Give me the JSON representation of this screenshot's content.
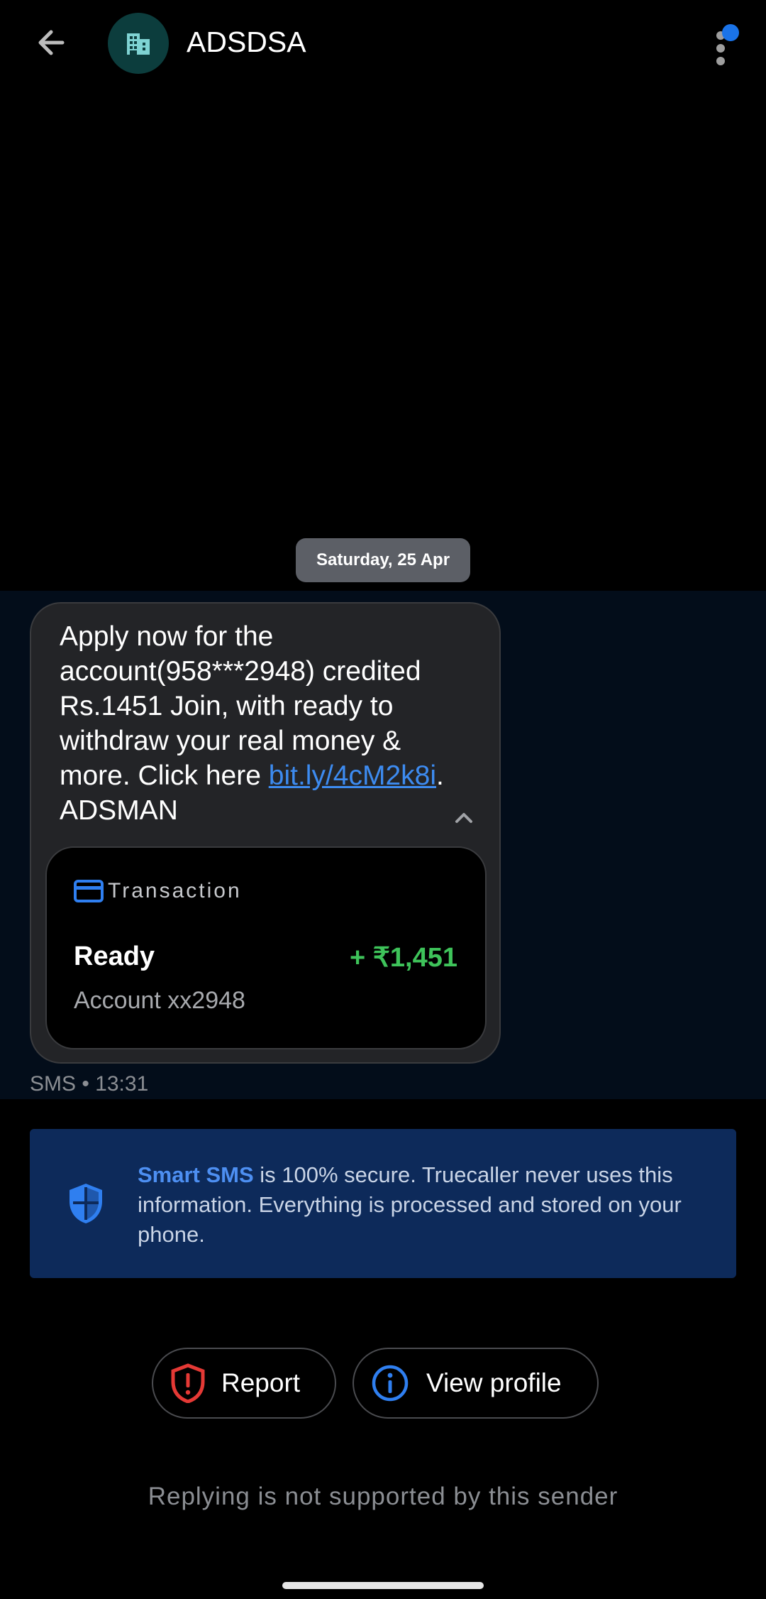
{
  "header": {
    "sender_name": "ADSDSA",
    "back_icon": "arrow-left-icon",
    "avatar_icon": "building-icon",
    "menu_icon": "more-vertical-icon",
    "notification_dot_color": "#1a73e8"
  },
  "conversation": {
    "date": "Saturday, 25 Apr",
    "message": {
      "text_before_link": "Apply now for the account(958***2948) credited Rs.1451 Join, with ready to withdraw your real money & more. Click here ",
      "link": "bit.ly/4cM2k8i",
      "text_after_link": ". ADSMAN",
      "meta": "SMS • 13:31"
    },
    "transaction_card": {
      "label": "Transaction",
      "status": "Ready",
      "amount": "+ ₹1,451",
      "account": "Account xx2948",
      "amount_color": "#3ec35a"
    }
  },
  "smart_sms": {
    "highlight": "Smart SMS",
    "text": " is 100% secure. Truecaller never uses this information. Everything is processed and stored on your phone.",
    "icon": "shield-icon"
  },
  "actions": {
    "report_label": "Report",
    "view_profile_label": "View profile"
  },
  "footer": {
    "reply_note": "Replying is not supported by this sender"
  },
  "colors": {
    "background": "#000000",
    "bubble": "#232427",
    "banner": "#0d2a5a",
    "accent": "#3d8bf0",
    "report_red": "#e53935"
  }
}
